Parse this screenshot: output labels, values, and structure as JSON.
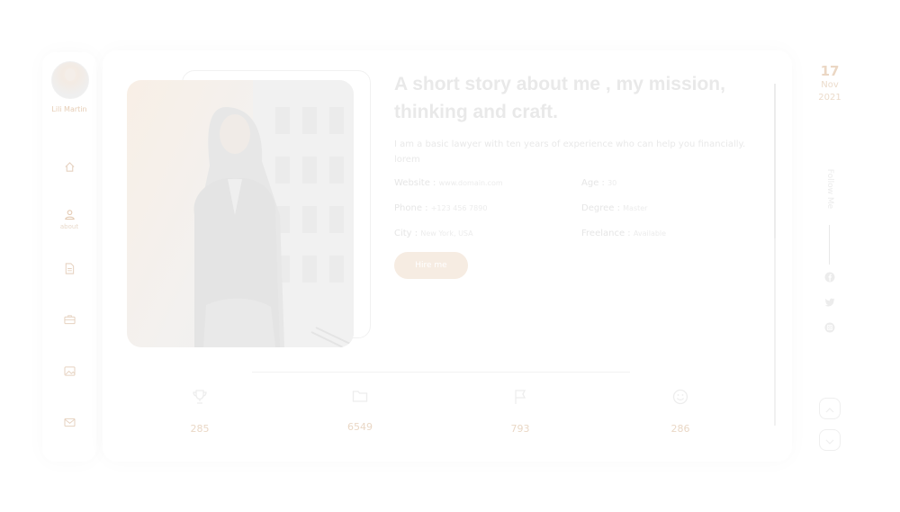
{
  "profile": {
    "name": "Lili Martin"
  },
  "nav": {
    "items": [
      {
        "icon": "home-icon",
        "label": ""
      },
      {
        "icon": "user-icon",
        "label": "about"
      },
      {
        "icon": "document-icon",
        "label": ""
      },
      {
        "icon": "briefcase-icon",
        "label": ""
      },
      {
        "icon": "image-icon",
        "label": ""
      },
      {
        "icon": "mail-icon",
        "label": ""
      }
    ]
  },
  "about": {
    "title": "A short story about me , my mission, thinking and craft.",
    "description": "I am a basic lawyer with ten years of experience who can help you financially. lorem",
    "info": [
      {
        "key": "Website",
        "value": "www.domain.com"
      },
      {
        "key": "Age",
        "value": "30"
      },
      {
        "key": "Phone",
        "value": "+123 456 7890"
      },
      {
        "key": "Degree",
        "value": "Master"
      },
      {
        "key": "City",
        "value": "New York, USA"
      },
      {
        "key": "Freelance",
        "value": "Available"
      }
    ],
    "hire_label": "Hire me"
  },
  "stats": [
    {
      "icon": "trophy-icon",
      "value": "285"
    },
    {
      "icon": "folder-icon",
      "value": "6549"
    },
    {
      "icon": "flag-icon",
      "value": "793"
    },
    {
      "icon": "smiley-icon",
      "value": "286"
    }
  ],
  "date": {
    "day": "17",
    "month": "Nov",
    "year": "2021"
  },
  "follow_label": "Follow Me",
  "social": [
    "facebook-icon",
    "twitter-icon",
    "instagram-icon"
  ],
  "colors": {
    "accent": "#f6ece2",
    "accent_text": "#e6cdb5",
    "text_faded": "#e9e9e9"
  }
}
